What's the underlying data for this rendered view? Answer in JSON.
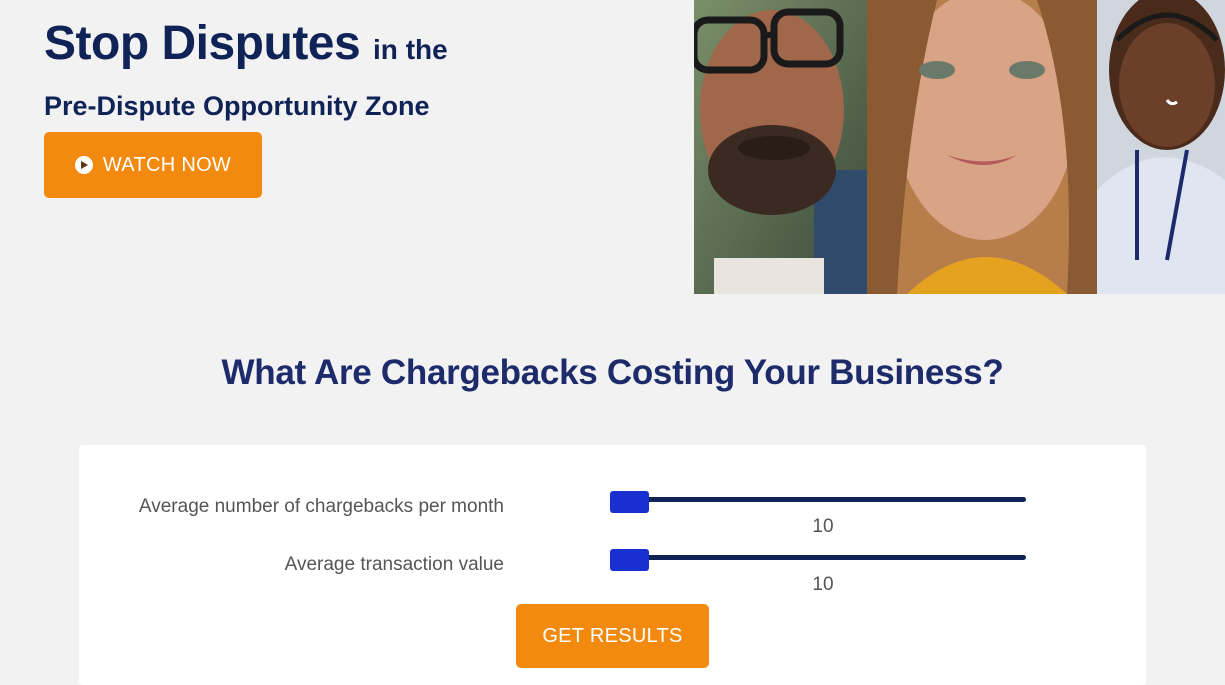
{
  "hero": {
    "title_main": "Stop Disputes",
    "title_tail": "in the",
    "subtitle": "Pre-Dispute Opportunity Zone",
    "watch_button": "WATCH NOW",
    "icon": "play-circle-icon"
  },
  "calculator": {
    "heading": "What Are Chargebacks Costing Your Business?",
    "fields": [
      {
        "label": "Average number of chargebacks per month",
        "value": "10"
      },
      {
        "label": "Average transaction value",
        "value": "10"
      }
    ],
    "submit_button": "GET RESULTS"
  },
  "colors": {
    "accent_orange": "#f38a10",
    "navy": "#0f2357",
    "heading_blue": "#1d2b6b",
    "slider_thumb": "#1a2fd0",
    "page_bg": "#f2f2f2"
  }
}
